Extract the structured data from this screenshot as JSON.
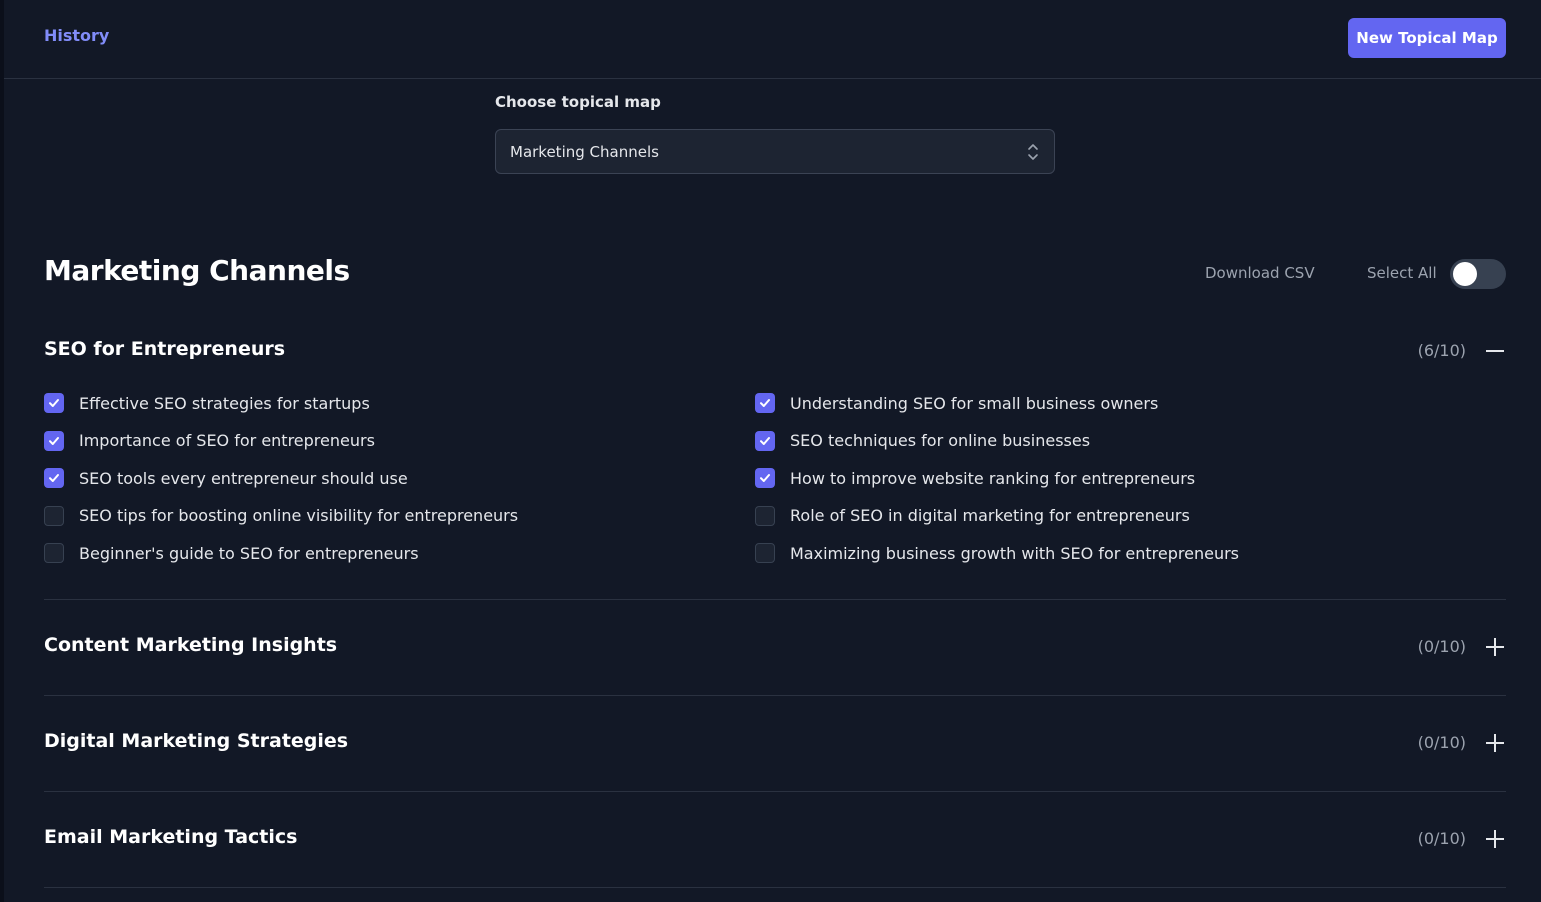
{
  "header": {
    "history_label": "History",
    "new_map_label": "New Topical Map"
  },
  "chooser": {
    "label": "Choose topical map",
    "selected": "Marketing Channels"
  },
  "map": {
    "title": "Marketing Channels",
    "download_label": "Download CSV",
    "select_all_label": "Select All",
    "select_all_on": false
  },
  "colors": {
    "accent": "#6366f1",
    "link": "#818cf8",
    "background": "#121826"
  },
  "sections": [
    {
      "title": "SEO for Entrepreneurs",
      "count": "(6/10)",
      "expanded": true,
      "toggle_icon": "minus-icon",
      "topics": [
        {
          "label": "Effective SEO strategies for startups",
          "checked": true
        },
        {
          "label": "Understanding SEO for small business owners",
          "checked": true
        },
        {
          "label": "Importance of SEO for entrepreneurs",
          "checked": true
        },
        {
          "label": "SEO techniques for online businesses",
          "checked": true
        },
        {
          "label": "SEO tools every entrepreneur should use",
          "checked": true
        },
        {
          "label": "How to improve website ranking for entrepreneurs",
          "checked": true
        },
        {
          "label": "SEO tips for boosting online visibility for entrepreneurs",
          "checked": false
        },
        {
          "label": "Role of SEO in digital marketing for entrepreneurs",
          "checked": false
        },
        {
          "label": "Beginner's guide to SEO for entrepreneurs",
          "checked": false
        },
        {
          "label": "Maximizing business growth with SEO for entrepreneurs",
          "checked": false
        }
      ]
    },
    {
      "title": "Content Marketing Insights",
      "count": "(0/10)",
      "expanded": false,
      "toggle_icon": "plus-icon"
    },
    {
      "title": "Digital Marketing Strategies",
      "count": "(0/10)",
      "expanded": false,
      "toggle_icon": "plus-icon"
    },
    {
      "title": "Email Marketing Tactics",
      "count": "(0/10)",
      "expanded": false,
      "toggle_icon": "plus-icon"
    }
  ]
}
